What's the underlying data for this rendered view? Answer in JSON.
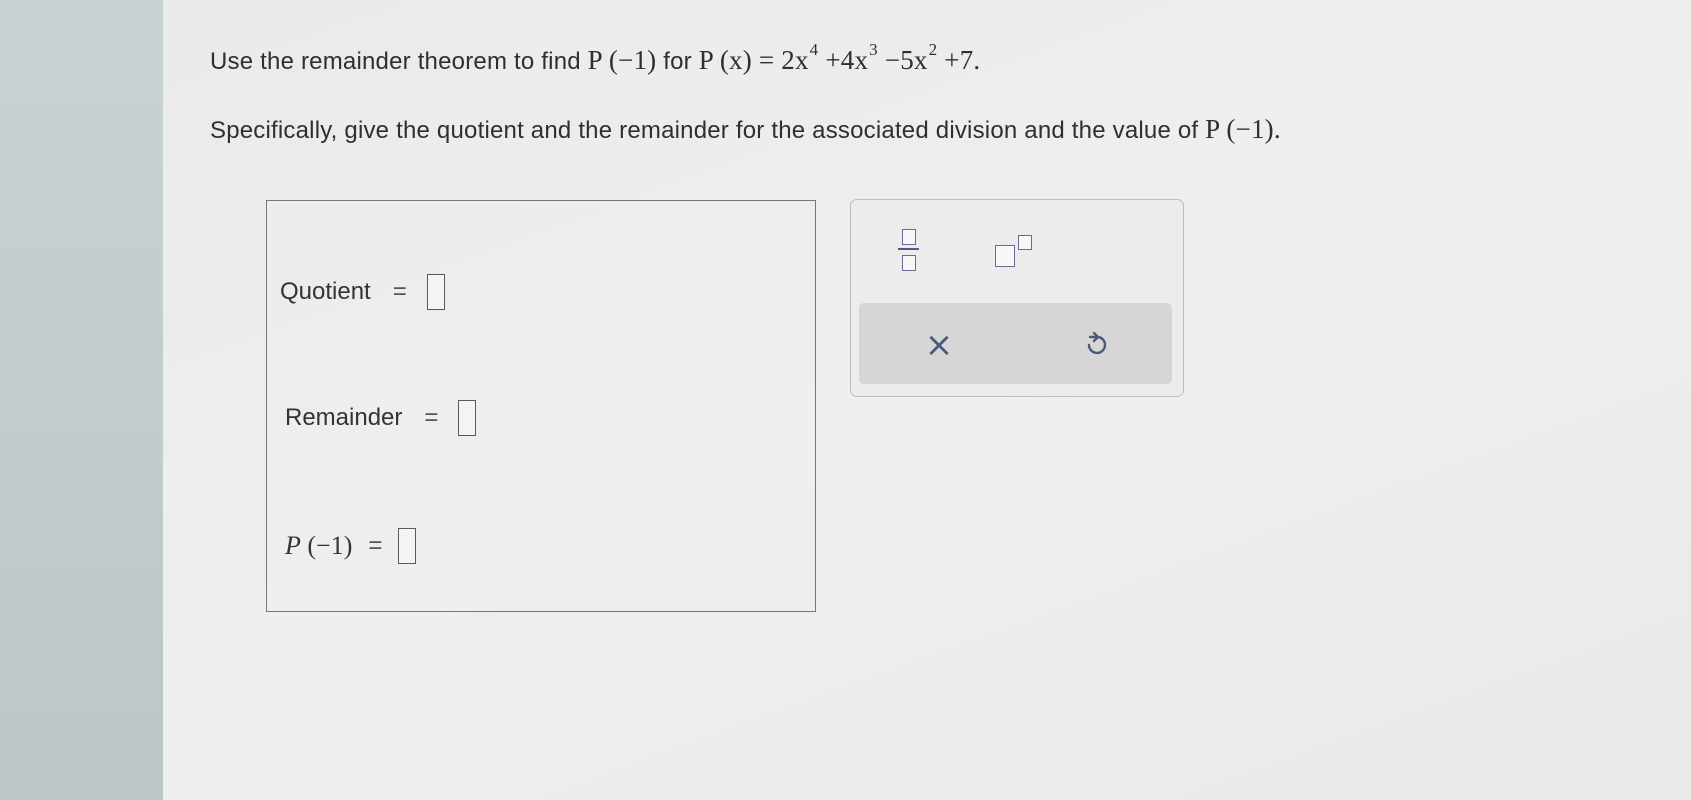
{
  "question": {
    "line1_text": "Use the remainder theorem to find ",
    "line1_p_of_neg1": "P (−1)",
    "line1_for": " for ",
    "polynomial_lhs": "P (x) = 2x",
    "polynomial_exp1": "4",
    "polynomial_term2": " +4x",
    "polynomial_exp2": "3",
    "polynomial_term3": " −5x",
    "polynomial_exp3": "2",
    "polynomial_tail": " +7.",
    "line2_text": "Specifically, give the quotient and the remainder for the associated division and the value of ",
    "line2_p_of_neg1": "P (−1)."
  },
  "answer_panel": {
    "quotient_label": "Quotient",
    "remainder_label": "Remainder",
    "p_label_name": "P",
    "p_label_arg": " (−1)",
    "equals": "=",
    "quotient_value": "",
    "remainder_value": "",
    "p_value": ""
  },
  "toolbar": {
    "buttons": [
      "fraction",
      "exponent",
      "clear",
      "undo"
    ],
    "clear_symbol": "×"
  },
  "colors": {
    "icon_accent": "#4a5a7a",
    "slot_border": "#5a5a5a",
    "toolbar_strip": "#d6d6d6"
  }
}
